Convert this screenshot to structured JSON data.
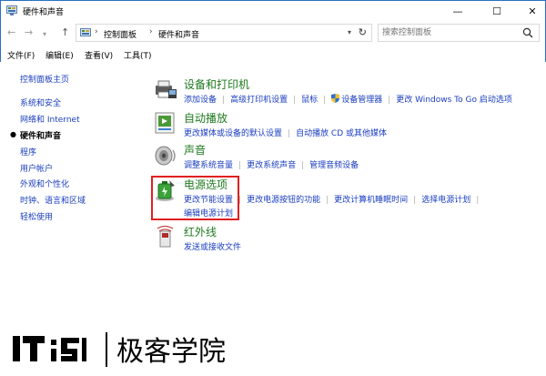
{
  "window": {
    "title": "硬件和声音",
    "minimize": "—",
    "maximize": "☐",
    "close": "✕"
  },
  "address": {
    "crumbs": [
      "控制面板",
      "硬件和声音"
    ],
    "search_placeholder": "搜索控制面板"
  },
  "menu": {
    "items": [
      "文件(F)",
      "编辑(E)",
      "查看(V)",
      "工具(T)"
    ]
  },
  "sidebar": {
    "items": [
      {
        "label": "控制面板主页",
        "current": false
      },
      {
        "label": "系统和安全",
        "current": false
      },
      {
        "label": "网络和 Internet",
        "current": false
      },
      {
        "label": "硬件和声音",
        "current": true
      },
      {
        "label": "程序",
        "current": false
      },
      {
        "label": "用户帐户",
        "current": false
      },
      {
        "label": "外观和个性化",
        "current": false
      },
      {
        "label": "时钟、语言和区域",
        "current": false
      },
      {
        "label": "轻松使用",
        "current": false
      }
    ]
  },
  "categories": [
    {
      "title": "设备和打印机",
      "links": [
        "添加设备",
        "高级打印机设置",
        "鼠标",
        "设备管理器",
        "更改 Windows To Go 启动选项"
      ],
      "icon": "printer-icon"
    },
    {
      "title": "自动播放",
      "links": [
        "更改媒体或设备的默认设置",
        "自动播放 CD 或其他媒体"
      ],
      "icon": "autoplay-icon"
    },
    {
      "title": "声音",
      "links": [
        "调整系统音量",
        "更改系统声音",
        "管理音频设备"
      ],
      "icon": "speaker-icon"
    },
    {
      "title": "电源选项",
      "links": [
        "更改节能设置",
        "更改电源按钮的功能",
        "更改计算机睡眠时间",
        "选择电源计划"
      ],
      "links2": [
        "编辑电源计划"
      ],
      "icon": "power-icon"
    },
    {
      "title": "红外线",
      "links": [
        "发送或接收文件"
      ],
      "icon": "infrared-icon"
    }
  ],
  "watermark": {
    "brand_latin": "IT",
    "brand_cn": "极客学院"
  },
  "colors": {
    "link": "#1a3dbf",
    "category_title": "#1f7a1f",
    "highlight": "#e11f1f",
    "window_border": "#2b6fc4"
  }
}
